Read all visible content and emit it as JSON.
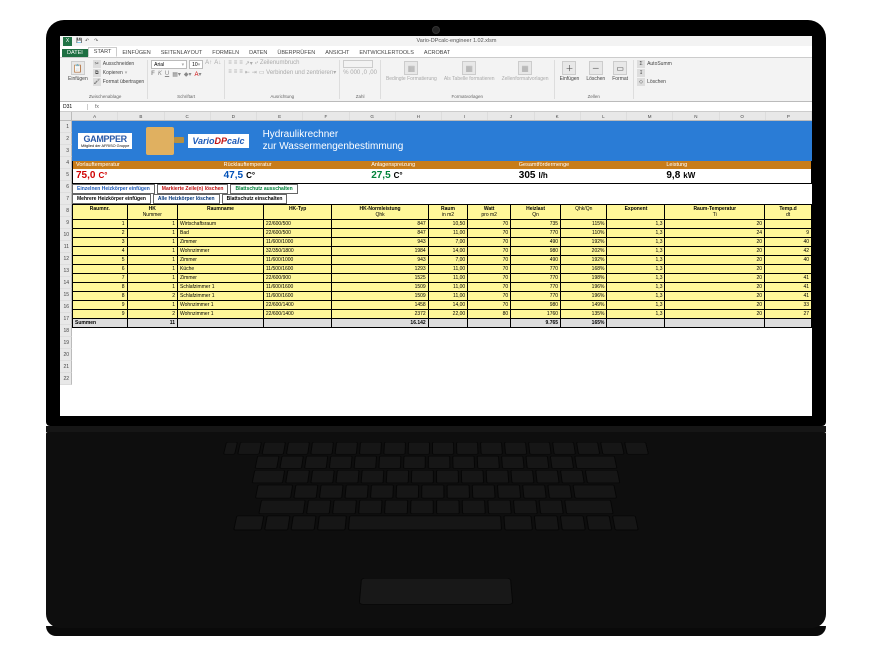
{
  "titlebar": {
    "filename": "Vario-DPcalc-engineer 1.02.xlsm"
  },
  "ribbon": {
    "tabs": [
      "DATEI",
      "START",
      "EINFÜGEN",
      "SEITENLAYOUT",
      "FORMELN",
      "DATEN",
      "ÜBERPRÜFEN",
      "ANSICHT",
      "ENTWICKLERTOOLS",
      "ACROBAT"
    ],
    "clipboard": {
      "paste": "Einfügen",
      "cut": "Ausschneiden",
      "copy": "Kopieren",
      "format_painter": "Format übertragen",
      "group": "Zwischenablage"
    },
    "font": {
      "name": "Arial",
      "size": "10",
      "group": "Schriftart"
    },
    "align": {
      "wrap": "Zeilenumbruch",
      "merge": "Verbinden und zentrieren",
      "group": "Ausrichtung"
    },
    "number": {
      "group": "Zahl"
    },
    "styles": {
      "cond": "Bedingte Formatierung",
      "table": "Als Tabelle formatieren",
      "cell": "Zellenformatvorlagen",
      "group": "Formatvorlagen"
    },
    "cells": {
      "insert": "Einfügen",
      "delete": "Löschen",
      "format": "Format",
      "group": "Zellen"
    },
    "editing": {
      "autosum": "AutoSumm",
      "fill": "",
      "clear": "Löschen"
    }
  },
  "formula": {
    "cell": "D31",
    "fx": "fx"
  },
  "cols": [
    "A",
    "B",
    "C",
    "D",
    "E",
    "F",
    "G",
    "H",
    "I",
    "J",
    "K",
    "L",
    "M",
    "N",
    "O",
    "P"
  ],
  "rows": [
    "1",
    "2",
    "3",
    "4",
    "5",
    "6",
    "7",
    "8",
    "9",
    "10",
    "11",
    "12",
    "13",
    "14",
    "15",
    "16",
    "17",
    "18",
    "19",
    "20",
    "21",
    "22"
  ],
  "hero": {
    "logo": "GAMPPER",
    "logo_sub": "Mitglied der AFRISO Gruppe",
    "vario_pre": "Vario",
    "vario_mid": "DP",
    "vario_post": "calc",
    "title1": "Hydraulikrechner",
    "title2": "zur Wassermengenbestimmung"
  },
  "params": [
    {
      "label": "Vorlauftemperatur",
      "value": "75,0",
      "unit": "C°",
      "cls": "c-red"
    },
    {
      "label": "Rücklauftemperatur",
      "value": "47,5",
      "unit": "C°",
      "cls": "c-blue"
    },
    {
      "label": "Anlagenspreizung",
      "value": "27,5",
      "unit": "C°",
      "cls": "c-grn"
    },
    {
      "label": "Gesamtfördermenge",
      "value": "305",
      "unit": "l/h",
      "cls": "c-blk"
    },
    {
      "label": "Leistung",
      "value": "9,8",
      "unit": "kW",
      "cls": "c-blk"
    }
  ],
  "actions": {
    "r1": [
      {
        "label": "Einzelnen Heizkörper einfügen",
        "cls": "act-blue"
      },
      {
        "label": "Markierte Zeile(n) löschen",
        "cls": "act-red"
      },
      {
        "label": "Blattschutz ausschalten",
        "cls": "act-grn"
      }
    ],
    "r2": [
      {
        "label": "Mehrere Heizkörper einfügen",
        "cls": "act-plain"
      },
      {
        "label": "Alle Heizkörper löschen",
        "cls": "act-navy"
      },
      {
        "label": "Blattschutz einschalten",
        "cls": "act-plain"
      }
    ]
  },
  "columns": [
    {
      "h": "Raumnr.",
      "sub": ""
    },
    {
      "h": "HK",
      "sub": "Nummer"
    },
    {
      "h": "Raumname",
      "sub": ""
    },
    {
      "h": "HK-Typ",
      "sub": ""
    },
    {
      "h": "HK-Normleistung",
      "sub": "Qhk"
    },
    {
      "h": "Raum",
      "sub": "in m2"
    },
    {
      "h": "Watt",
      "sub": "pro m2"
    },
    {
      "h": "Heizlast",
      "sub": "Qn"
    },
    {
      "h": "",
      "sub": "Qhk/Qn"
    },
    {
      "h": "Exponent",
      "sub": ""
    },
    {
      "h": "Raum-Temperatur",
      "sub": "Ti"
    },
    {
      "h": "Temp.d",
      "sub": "dt"
    }
  ],
  "rows_data": [
    [
      "1",
      "1",
      "Wirtschaftsraum",
      "22/600/500",
      "847",
      "10,50",
      "70",
      "735",
      "115%",
      "1,3",
      "20",
      ""
    ],
    [
      "2",
      "1",
      "Bad",
      "22/600/500",
      "847",
      "11,00",
      "70",
      "770",
      "110%",
      "1,3",
      "24",
      "9"
    ],
    [
      "3",
      "1",
      "Zimmer",
      "11/600/1000",
      "943",
      "7,00",
      "70",
      "490",
      "192%",
      "1,3",
      "20",
      "40"
    ],
    [
      "4",
      "1",
      "Wohnzimmer",
      "32/350/1800",
      "1984",
      "14,00",
      "70",
      "980",
      "202%",
      "1,3",
      "20",
      "42"
    ],
    [
      "5",
      "1",
      "Zimmer",
      "11/600/1000",
      "943",
      "7,00",
      "70",
      "490",
      "192%",
      "1,3",
      "20",
      "40"
    ],
    [
      "6",
      "1",
      "Küche",
      "11/500/1600",
      "1293",
      "11,00",
      "70",
      "770",
      "168%",
      "1,3",
      "20",
      ""
    ],
    [
      "7",
      "1",
      "Zimmer",
      "22/600/900",
      "1525",
      "11,00",
      "70",
      "770",
      "198%",
      "1,3",
      "20",
      "41"
    ],
    [
      "8",
      "1",
      "Schlafzimmer 1",
      "11/600/1600",
      "1509",
      "11,00",
      "70",
      "770",
      "196%",
      "1,3",
      "20",
      "41"
    ],
    [
      "8",
      "2",
      "Schlafzimmer 1",
      "11/600/1600",
      "1509",
      "11,00",
      "70",
      "770",
      "196%",
      "1,3",
      "20",
      "41"
    ],
    [
      "9",
      "1",
      "Wohnzimmer 1",
      "22/600/1400",
      "1458",
      "14,00",
      "70",
      "980",
      "149%",
      "1,3",
      "20",
      "33"
    ],
    [
      "9",
      "2",
      "Wohnzimmer 1",
      "22/600/1400",
      "2372",
      "22,00",
      "80",
      "1760",
      "135%",
      "1,3",
      "20",
      "27"
    ]
  ],
  "sum": {
    "label": "Summen",
    "hk": "11",
    "qhk": "16.142",
    "qn": "9.765",
    "pct": "165%"
  },
  "kb_layout": [
    [
      12,
      22,
      22,
      22,
      22,
      22,
      22,
      22,
      22,
      22,
      22,
      22,
      22,
      22,
      22,
      22,
      22,
      22
    ],
    [
      22,
      22,
      22,
      22,
      22,
      22,
      22,
      22,
      22,
      22,
      22,
      22,
      22,
      40
    ],
    [
      30,
      22,
      22,
      22,
      22,
      22,
      22,
      22,
      22,
      22,
      22,
      22,
      22,
      32
    ],
    [
      34,
      22,
      22,
      22,
      22,
      22,
      22,
      22,
      22,
      22,
      22,
      22,
      40
    ],
    [
      42,
      22,
      22,
      22,
      22,
      22,
      22,
      22,
      22,
      22,
      22,
      44
    ],
    [
      26,
      22,
      22,
      26,
      140,
      26,
      22,
      22,
      22,
      22
    ]
  ]
}
